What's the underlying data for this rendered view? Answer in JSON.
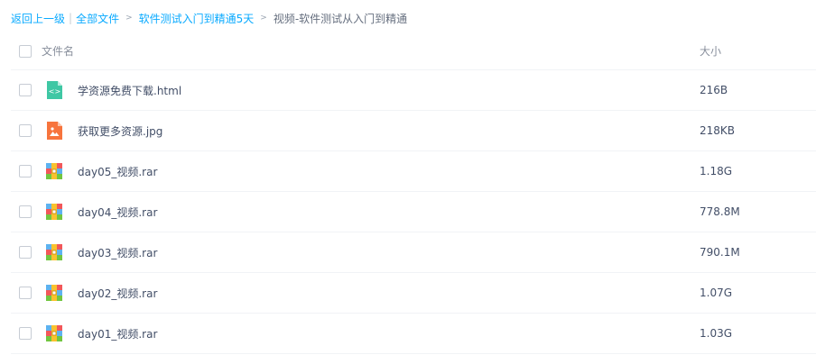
{
  "breadcrumb": {
    "back": "返回上一级",
    "all_files": "全部文件",
    "parent_folder": "软件测试入门到精通5天",
    "current_folder": "视频-软件测试从入门到精通"
  },
  "table": {
    "col_name": "文件名",
    "col_size": "大小",
    "rows": [
      {
        "name": "学资源免费下载.html",
        "size": "216B",
        "icon": "html-file-icon"
      },
      {
        "name": "获取更多资源.jpg",
        "size": "218KB",
        "icon": "image-file-icon"
      },
      {
        "name": "day05_视频.rar",
        "size": "1.18G",
        "icon": "archive-file-icon"
      },
      {
        "name": "day04_视频.rar",
        "size": "778.8M",
        "icon": "archive-file-icon"
      },
      {
        "name": "day03_视频.rar",
        "size": "790.1M",
        "icon": "archive-file-icon"
      },
      {
        "name": "day02_视频.rar",
        "size": "1.07G",
        "icon": "archive-file-icon"
      },
      {
        "name": "day01_视频.rar",
        "size": "1.03G",
        "icon": "archive-file-icon"
      }
    ]
  },
  "colors": {
    "link": "#09aaff",
    "html_icon": "#3fc7a4",
    "image_icon": "#f7743d"
  }
}
